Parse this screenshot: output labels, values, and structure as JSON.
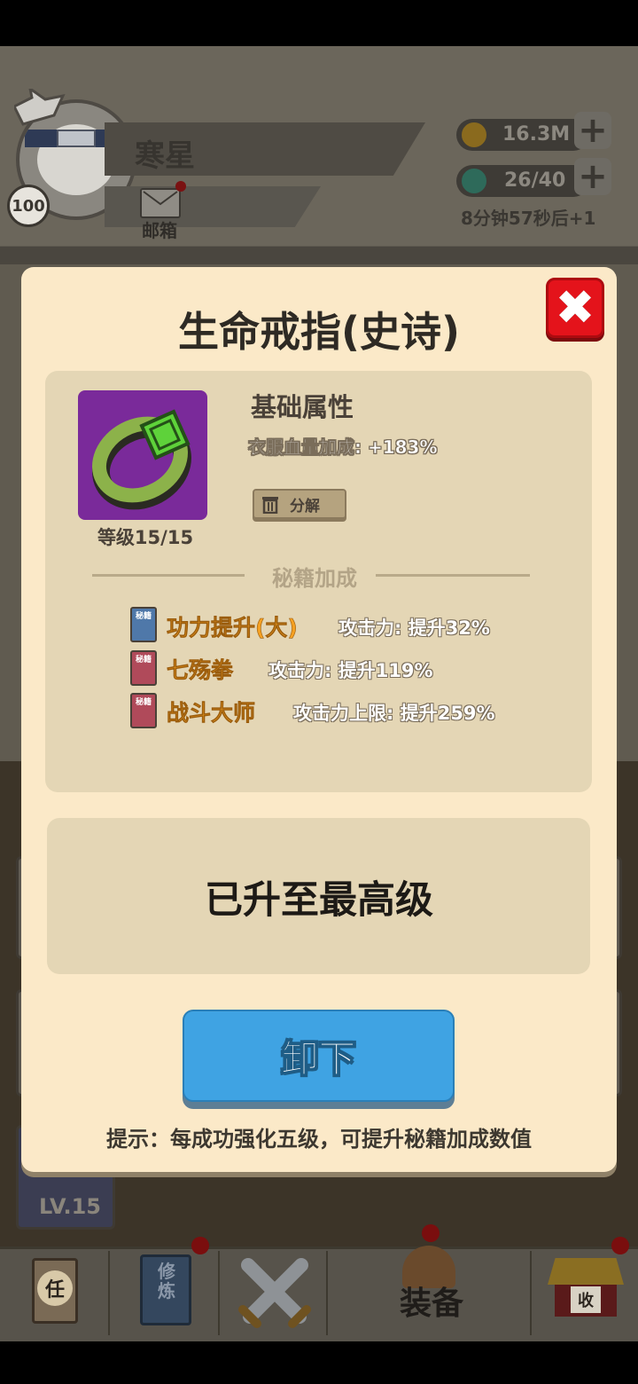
{
  "player": {
    "name": "寒星",
    "level": "100",
    "mail_label": "邮箱"
  },
  "resources": {
    "coins": "16.3M",
    "energy": "26/40",
    "timer": "8分钟57秒后+1"
  },
  "modal": {
    "title": "生命戒指(史诗)",
    "item_level": "等级15/15",
    "base_attr_title": "基础属性",
    "base_attr_line": "衣服血量加成: +183%",
    "decompose_label": "分解",
    "section_title": "秘籍加成",
    "skills": [
      {
        "name": "功力提升(大)",
        "effect": "攻击力: 提升32%",
        "book": "秘籍",
        "color": "#4f78a9"
      },
      {
        "name": "七殇拳",
        "effect": "攻击力: 提升119%",
        "book": "秘籍",
        "color": "#b04a5a"
      },
      {
        "name": "战斗大师",
        "effect": "攻击力上限: 提升259%",
        "book": "秘籍",
        "color": "#b04a5a"
      }
    ],
    "max_level_text": "已升至最高级",
    "unequip_label": "卸下",
    "hint": "提示：每成功强化五级，可提升秘籍加成数值"
  },
  "background": {
    "card_level": "LV.15",
    "nav": [
      {
        "label": "任",
        "icon": "task-scroll-icon"
      },
      {
        "label": "修炼",
        "icon": "training-book-icon"
      },
      {
        "label": "",
        "icon": "crossed-swords-icon"
      },
      {
        "label": "装备",
        "icon": "equipment-icon"
      },
      {
        "label": "收",
        "icon": "shop-icon"
      }
    ]
  }
}
